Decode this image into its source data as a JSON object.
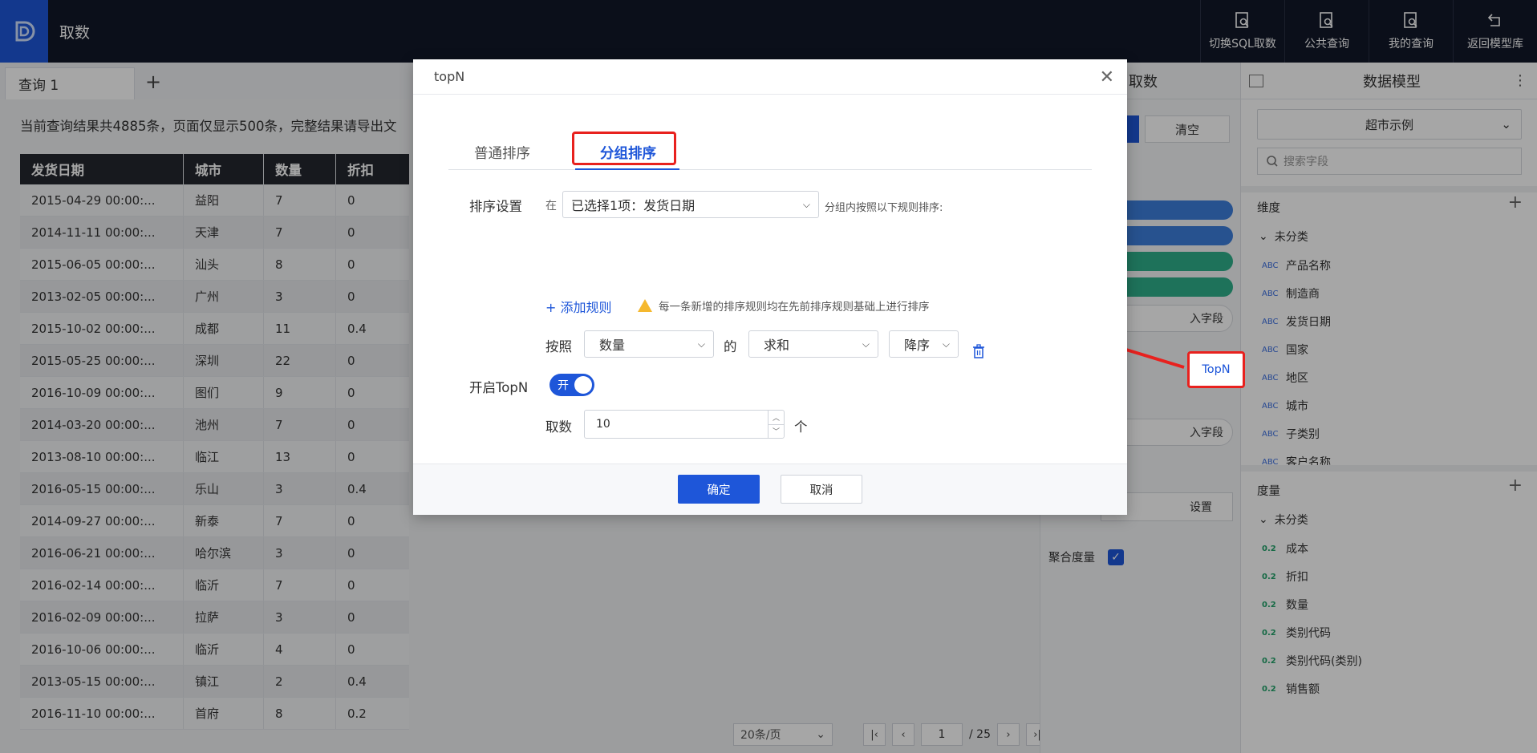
{
  "app": {
    "title": "取数"
  },
  "top_actions": [
    {
      "label": "切换SQL取数",
      "icon": "sql-doc-icon"
    },
    {
      "label": "公共查询",
      "icon": "public-query-icon"
    },
    {
      "label": "我的查询",
      "icon": "my-query-icon"
    },
    {
      "label": "返回模型库",
      "icon": "return-icon"
    }
  ],
  "tabs": [
    {
      "label": "查询 1"
    }
  ],
  "result_info": "当前查询结果共4885条，页面仅显示500条，完整结果请导出文",
  "table": {
    "headers": [
      "发货日期",
      "城市",
      "数量",
      "折扣"
    ],
    "rows": [
      [
        "2015-04-29 00:00:...",
        "益阳",
        "7",
        "0"
      ],
      [
        "2014-11-11 00:00:...",
        "天津",
        "7",
        "0"
      ],
      [
        "2015-06-05 00:00:...",
        "汕头",
        "8",
        "0"
      ],
      [
        "2013-02-05 00:00:...",
        "广州",
        "3",
        "0"
      ],
      [
        "2015-10-02 00:00:...",
        "成都",
        "11",
        "0.4"
      ],
      [
        "2015-05-25 00:00:...",
        "深圳",
        "22",
        "0"
      ],
      [
        "2016-10-09 00:00:...",
        "图们",
        "9",
        "0"
      ],
      [
        "2014-03-20 00:00:...",
        "池州",
        "7",
        "0"
      ],
      [
        "2013-08-10 00:00:...",
        "临江",
        "13",
        "0"
      ],
      [
        "2016-05-15 00:00:...",
        "乐山",
        "3",
        "0.4"
      ],
      [
        "2014-09-27 00:00:...",
        "新泰",
        "7",
        "0"
      ],
      [
        "2016-06-21 00:00:...",
        "哈尔滨",
        "3",
        "0"
      ],
      [
        "2016-02-14 00:00:...",
        "临沂",
        "7",
        "0"
      ],
      [
        "2016-02-09 00:00:...",
        "拉萨",
        "3",
        "0"
      ],
      [
        "2016-10-06 00:00:...",
        "临沂",
        "4",
        "0"
      ],
      [
        "2013-05-15 00:00:...",
        "镇江",
        "2",
        "0.4"
      ],
      [
        "2016-11-10 00:00:...",
        "首府",
        "8",
        "0.2"
      ]
    ]
  },
  "pager": {
    "page_size": "20条/页",
    "current": "1",
    "total": "/ 25"
  },
  "mid_panel": {
    "title": "取数",
    "clear_label": "清空",
    "field_placeholder_1": "入字段",
    "field_placeholder_2": "入字段",
    "settings_label": "设置",
    "agg_label": "聚合度量",
    "topn_label": "TopN",
    "pill_colors": [
      "#3d7fdc",
      "#3d7fdc",
      "#2fb08a",
      "#2fb08a"
    ]
  },
  "right_panel": {
    "title": "数据模型",
    "model_select": "超市示例",
    "search_placeholder": "搜索字段",
    "dimension_label": "维度",
    "dimension_group": "未分类",
    "dimensions": [
      "产品名称",
      "制造商",
      "发货日期",
      "国家",
      "地区",
      "城市",
      "子类别",
      "客户名称"
    ],
    "measure_label": "度量",
    "measure_group": "未分类",
    "measures": [
      "成本",
      "折扣",
      "数量",
      "类别代码",
      "类别代码(类别)",
      "销售额"
    ],
    "measure_tag": "0.2",
    "dim_tag": "ABC"
  },
  "modal": {
    "title": "topN",
    "tab_normal": "普通排序",
    "tab_group": "分组排序",
    "sort_setting_label": "排序设置",
    "in_label": "在",
    "group_select": "已选择1项：发货日期",
    "group_hint": "分组内按照以下规则排序:",
    "add_rule": "+ 添加规则",
    "warn_text": "每一条新增的排序规则均在先前排序规则基础上进行排序",
    "by_label": "按照",
    "field_select": "数量",
    "of_label": "的",
    "agg_select": "求和",
    "order_select": "降序",
    "topn_label": "开启TopN",
    "toggle_label": "开",
    "count_label": "取数",
    "count_value": "10",
    "unit_label": "个",
    "ok_label": "确定",
    "cancel_label": "取消"
  }
}
